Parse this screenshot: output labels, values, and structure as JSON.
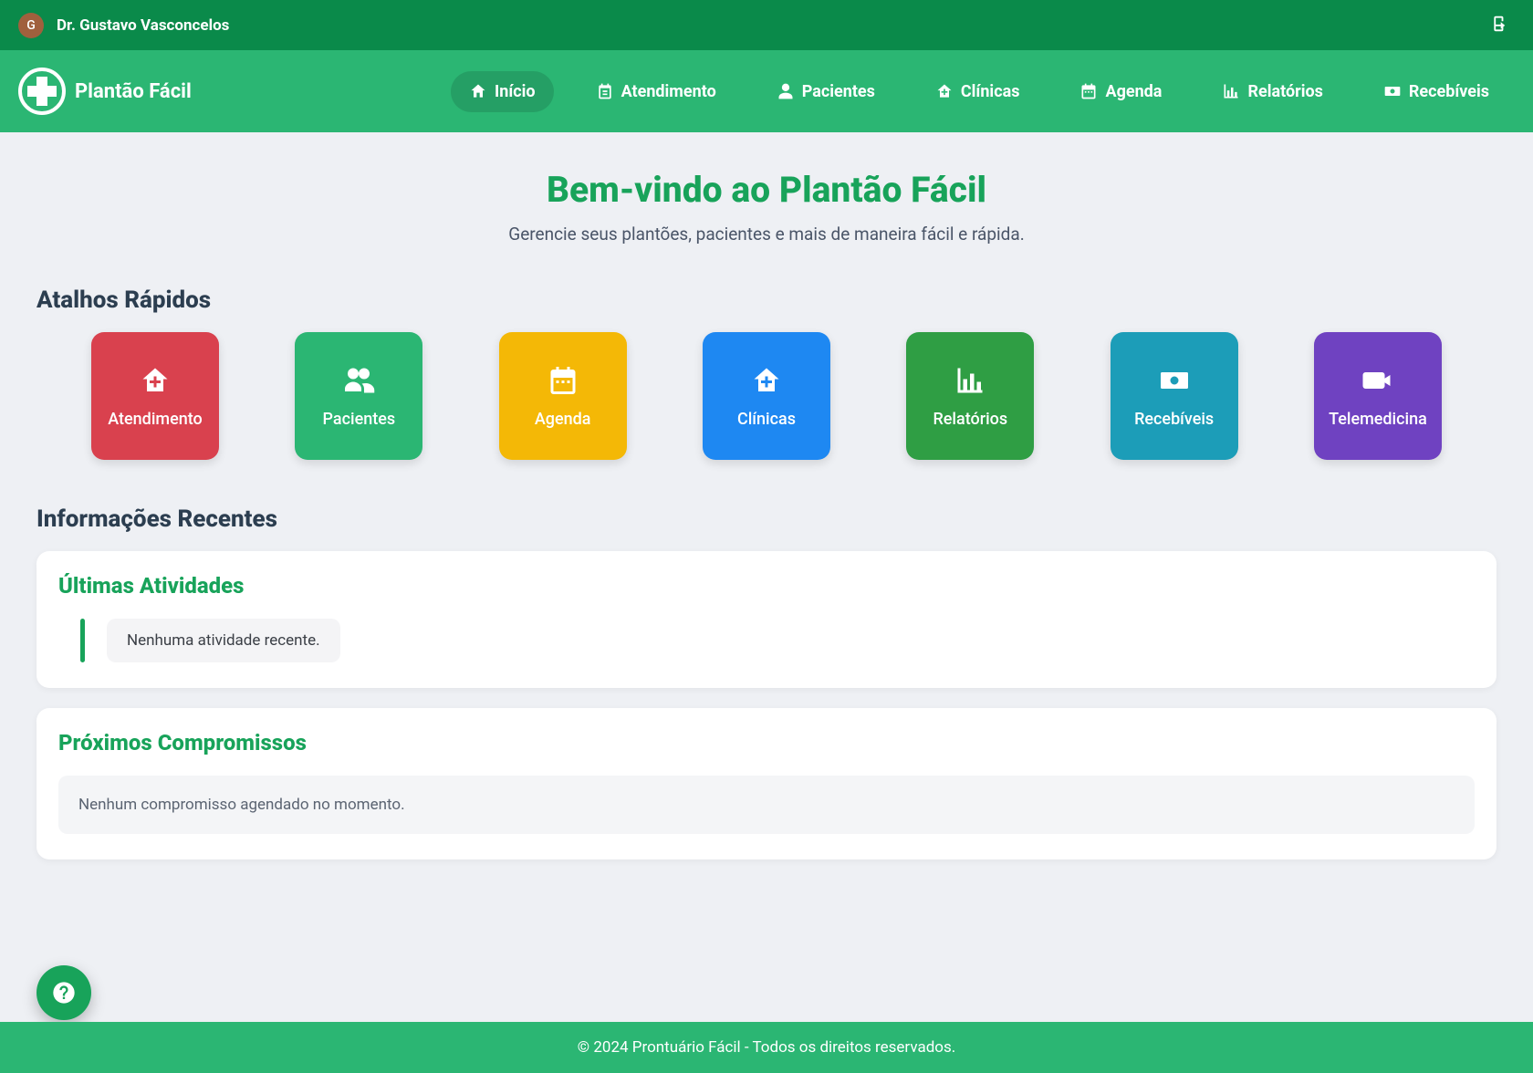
{
  "topbar": {
    "avatar_initial": "G",
    "user_name": "Dr. Gustavo Vasconcelos"
  },
  "brand": {
    "name": "Plantão Fácil"
  },
  "nav": {
    "inicio": "Início",
    "atendimento": "Atendimento",
    "pacientes": "Pacientes",
    "clinicas": "Clínicas",
    "agenda": "Agenda",
    "relatorios": "Relatórios",
    "recebiveis": "Recebíveis"
  },
  "welcome": {
    "title": "Bem-vindo ao Plantão Fácil",
    "subtitle": "Gerencie seus plantões, pacientes e mais de maneira fácil e rápida."
  },
  "sections": {
    "shortcuts_title": "Atalhos Rápidos",
    "recent_title": "Informações Recentes"
  },
  "shortcuts": {
    "atendimento": "Atendimento",
    "pacientes": "Pacientes",
    "agenda": "Agenda",
    "clinicas": "Clínicas",
    "relatorios": "Relatórios",
    "recebiveis": "Recebíveis",
    "telemedicina": "Telemedicina"
  },
  "cards": {
    "activities_title": "Últimas Atividades",
    "activities_empty": "Nenhuma atividade recente.",
    "appointments_title": "Próximos Compromissos",
    "appointments_empty": "Nenhum compromisso agendado no momento."
  },
  "footer": {
    "text": "© 2024 Prontuário Fácil - Todos os direitos reservados."
  },
  "colors": {
    "brand_green": "#2bb673",
    "dark_green": "#0a8a4a",
    "accent_green": "#18a35a"
  }
}
